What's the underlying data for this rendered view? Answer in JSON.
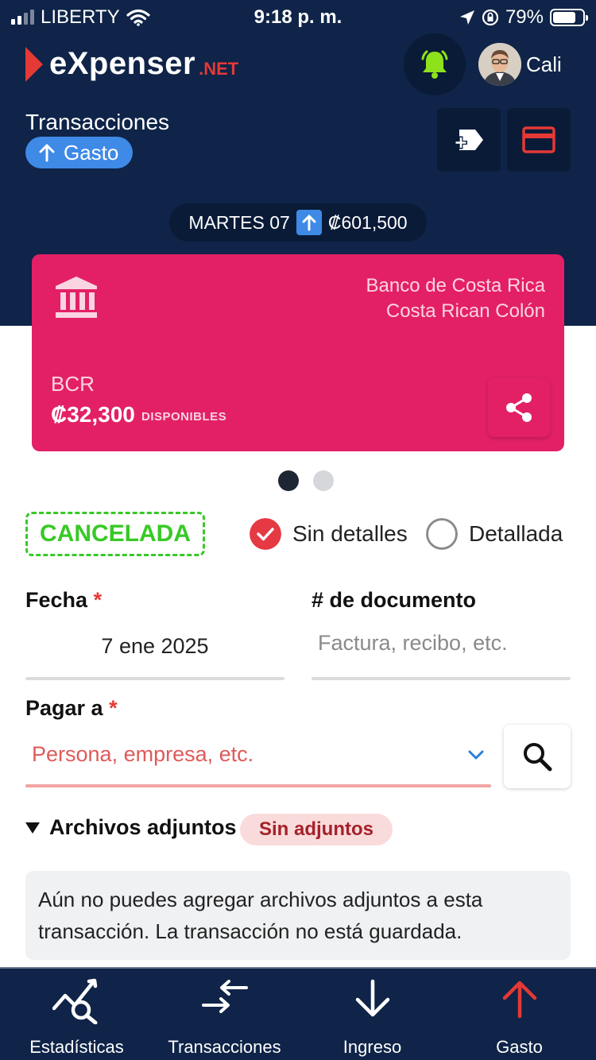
{
  "status_bar": {
    "carrier": "LIBERTY",
    "time": "9:18 p. m.",
    "battery": "79%",
    "battery_level": 0.79
  },
  "header": {
    "brand": "eXpenser",
    "brand_suffix": ".NET",
    "user_name": "Cali",
    "section_title": "Transacciones",
    "type_label": "Gasto"
  },
  "date_summary": {
    "day_label": "MARTES 07",
    "amount": "₡601,500"
  },
  "account_card": {
    "bank_name": "Banco de Costa Rica",
    "currency": "Costa Rican Colón",
    "code": "BCR",
    "balance": "₡32,300",
    "balance_label": "DISPONIBLES",
    "accent": "#e32066"
  },
  "carousel": {
    "pages": 2,
    "active": 1
  },
  "transaction_status": "CANCELADA",
  "detail_mode": {
    "options": [
      "Sin detalles",
      "Detallada"
    ],
    "selected": "Sin detalles"
  },
  "form": {
    "date_label": "Fecha",
    "date_value": "7 ene 2025",
    "doc_label": "# de documento",
    "doc_placeholder": "Factura, recibo, etc.",
    "doc_value": "",
    "payee_label": "Pagar a",
    "payee_placeholder": "Persona, empresa, etc.",
    "required_mark": "*"
  },
  "attachments": {
    "title": "Archivos adjuntos",
    "badge": "Sin adjuntos",
    "note": "Aún no puedes agregar archivos adjuntos a esta transacción. La transacción no está guardada."
  },
  "bottom_nav": [
    {
      "label": "Estadísticas",
      "icon": "stats-search-icon"
    },
    {
      "label": "Transacciones",
      "icon": "transfer-arrows-icon"
    },
    {
      "label": "Ingreso",
      "icon": "arrow-down-icon"
    },
    {
      "label": "Gasto",
      "icon": "arrow-up-icon"
    }
  ],
  "colors": {
    "navy": "#0f2448",
    "accent_blue": "#3e8ae6",
    "danger": "#e53935",
    "success": "#38c926",
    "bell": "#8de21b"
  }
}
